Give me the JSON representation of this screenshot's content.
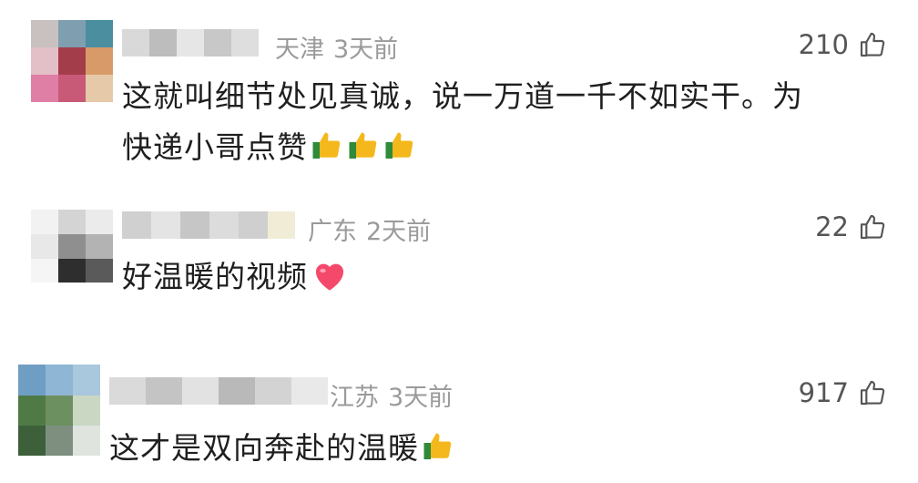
{
  "comments": [
    {
      "location": "天津",
      "time": "3天前",
      "likes": "210",
      "text_lines": [
        "这就叫细节处见真诚，说一万道一千不如实干。为",
        "快递小哥点赞"
      ],
      "emojis": [
        "thumbs-up",
        "thumbs-up",
        "thumbs-up"
      ]
    },
    {
      "location": "广东",
      "time": "2天前",
      "likes": "22",
      "text_lines": [
        "好温暖的视频"
      ],
      "emojis": [
        "heart"
      ]
    },
    {
      "location": "江苏",
      "time": "3天前",
      "likes": "917",
      "text_lines": [
        "这才是双向奔赴的温暖"
      ],
      "emojis": [
        "thumbs-up"
      ]
    }
  ],
  "colors": {
    "meta": "#9a9a9a",
    "text": "#1f1f1f",
    "likes": "#555555",
    "heart": "#f4496b",
    "thumb": "#f4b81c"
  }
}
